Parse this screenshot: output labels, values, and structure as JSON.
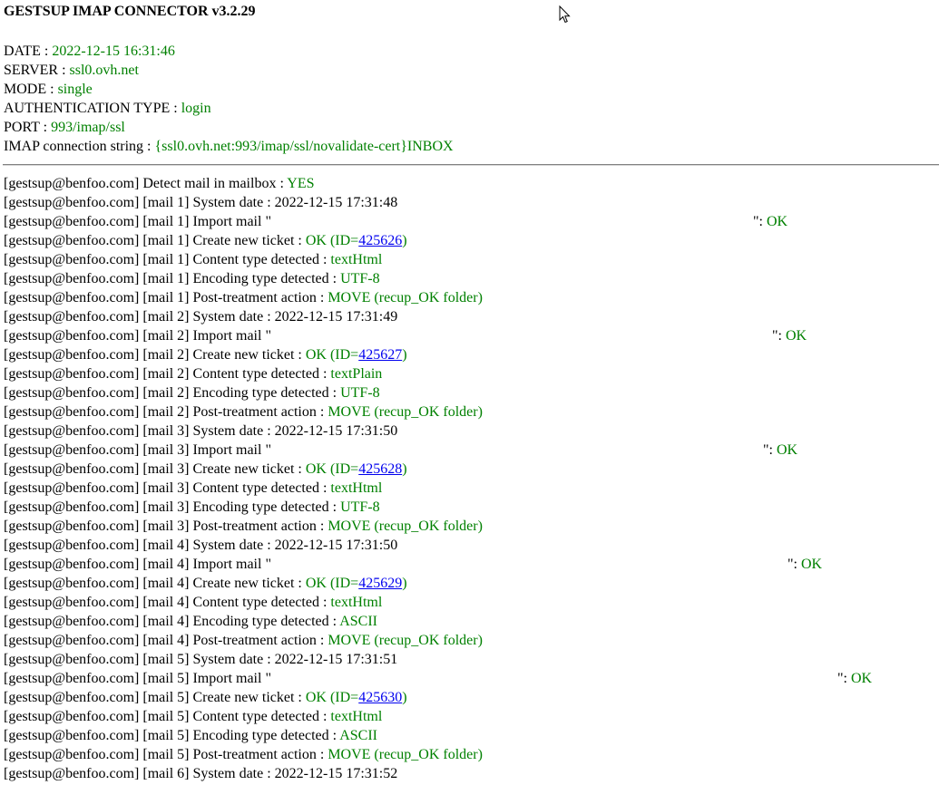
{
  "title": "GESTSUP IMAP CONNECTOR v3.2.29",
  "info": [
    {
      "label": "DATE : ",
      "value": "2022-12-15 16:31:46"
    },
    {
      "label": "SERVER : ",
      "value": "ssl0.ovh.net"
    },
    {
      "label": "MODE : ",
      "value": "single"
    },
    {
      "label": "AUTHENTICATION TYPE : ",
      "value": "login"
    },
    {
      "label": "PORT : ",
      "value": "993/imap/ssl"
    },
    {
      "label": "IMAP connection string : ",
      "value": "{ssl0.ovh.net:993/imap/ssl/novalidate-cert}INBOX"
    }
  ],
  "log": [
    {
      "type": "kv",
      "prefix": "[gestsup@benfoo.com] Detect mail in mailbox : ",
      "value": "YES"
    },
    {
      "type": "plain",
      "prefix": "[gestsup@benfoo.com] [mail 1] System date : 2022-12-15 17:31:48"
    },
    {
      "type": "import",
      "prefix": "[gestsup@benfoo.com] [mail 1] Import mail \"",
      "suffix": "\": ",
      "status": "OK"
    },
    {
      "type": "ticket",
      "prefix": "[gestsup@benfoo.com] [mail 1] Create new ticket : ",
      "ok": "OK (ID=",
      "id": "425626",
      "close": ")"
    },
    {
      "type": "kv",
      "prefix": "[gestsup@benfoo.com] [mail 1] Content type detected : ",
      "value": "textHtml"
    },
    {
      "type": "kv",
      "prefix": "[gestsup@benfoo.com] [mail 1] Encoding type detected : ",
      "value": "UTF-8"
    },
    {
      "type": "kv",
      "prefix": "[gestsup@benfoo.com] [mail 1] Post-treatment action : ",
      "value": "MOVE (recup_OK folder)"
    },
    {
      "type": "plain",
      "prefix": "[gestsup@benfoo.com] [mail 2] System date : 2022-12-15 17:31:49"
    },
    {
      "type": "import",
      "prefix": "[gestsup@benfoo.com] [mail 2] Import mail \"",
      "suffix": "\": ",
      "status": "OK"
    },
    {
      "type": "ticket",
      "prefix": "[gestsup@benfoo.com] [mail 2] Create new ticket : ",
      "ok": "OK (ID=",
      "id": "425627",
      "close": ")"
    },
    {
      "type": "kv",
      "prefix": "[gestsup@benfoo.com] [mail 2] Content type detected : ",
      "value": "textPlain"
    },
    {
      "type": "kv",
      "prefix": "[gestsup@benfoo.com] [mail 2] Encoding type detected : ",
      "value": "UTF-8"
    },
    {
      "type": "kv",
      "prefix": "[gestsup@benfoo.com] [mail 2] Post-treatment action : ",
      "value": "MOVE (recup_OK folder)"
    },
    {
      "type": "plain",
      "prefix": "[gestsup@benfoo.com] [mail 3] System date : 2022-12-15 17:31:50"
    },
    {
      "type": "import",
      "prefix": "[gestsup@benfoo.com] [mail 3] Import mail \"",
      "suffix": "\": ",
      "status": "OK"
    },
    {
      "type": "ticket",
      "prefix": "[gestsup@benfoo.com] [mail 3] Create new ticket : ",
      "ok": "OK (ID=",
      "id": "425628",
      "close": ")"
    },
    {
      "type": "kv",
      "prefix": "[gestsup@benfoo.com] [mail 3] Content type detected : ",
      "value": "textHtml"
    },
    {
      "type": "kv",
      "prefix": "[gestsup@benfoo.com] [mail 3] Encoding type detected : ",
      "value": "UTF-8"
    },
    {
      "type": "kv",
      "prefix": "[gestsup@benfoo.com] [mail 3] Post-treatment action : ",
      "value": "MOVE (recup_OK folder)"
    },
    {
      "type": "plain",
      "prefix": "[gestsup@benfoo.com] [mail 4] System date : 2022-12-15 17:31:50"
    },
    {
      "type": "import",
      "prefix": "[gestsup@benfoo.com] [mail 4] Import mail \"",
      "suffix": "\": ",
      "status": "OK"
    },
    {
      "type": "ticket",
      "prefix": "[gestsup@benfoo.com] [mail 4] Create new ticket : ",
      "ok": "OK (ID=",
      "id": "425629",
      "close": ")"
    },
    {
      "type": "kv",
      "prefix": "[gestsup@benfoo.com] [mail 4] Content type detected : ",
      "value": "textHtml"
    },
    {
      "type": "kv",
      "prefix": "[gestsup@benfoo.com] [mail 4] Encoding type detected : ",
      "value": "ASCII"
    },
    {
      "type": "kv",
      "prefix": "[gestsup@benfoo.com] [mail 4] Post-treatment action : ",
      "value": "MOVE (recup_OK folder)"
    },
    {
      "type": "plain",
      "prefix": "[gestsup@benfoo.com] [mail 5] System date : 2022-12-15 17:31:51"
    },
    {
      "type": "import",
      "prefix": "[gestsup@benfoo.com] [mail 5] Import mail \"",
      "suffix": "\": ",
      "status": "OK"
    },
    {
      "type": "ticket",
      "prefix": "[gestsup@benfoo.com] [mail 5] Create new ticket : ",
      "ok": "OK (ID=",
      "id": "425630",
      "close": ")"
    },
    {
      "type": "kv",
      "prefix": "[gestsup@benfoo.com] [mail 5] Content type detected : ",
      "value": "textHtml"
    },
    {
      "type": "kv",
      "prefix": "[gestsup@benfoo.com] [mail 5] Encoding type detected : ",
      "value": "ASCII"
    },
    {
      "type": "kv",
      "prefix": "[gestsup@benfoo.com] [mail 5] Post-treatment action : ",
      "value": "MOVE (recup_OK folder)"
    },
    {
      "type": "plain",
      "prefix": "[gestsup@benfoo.com] [mail 6] System date : 2022-12-15 17:31:52"
    }
  ],
  "colors": {
    "value": "#008000",
    "link": "#0000ee",
    "text": "#000000"
  },
  "icons": {
    "cursor": "mouse-pointer-icon"
  }
}
